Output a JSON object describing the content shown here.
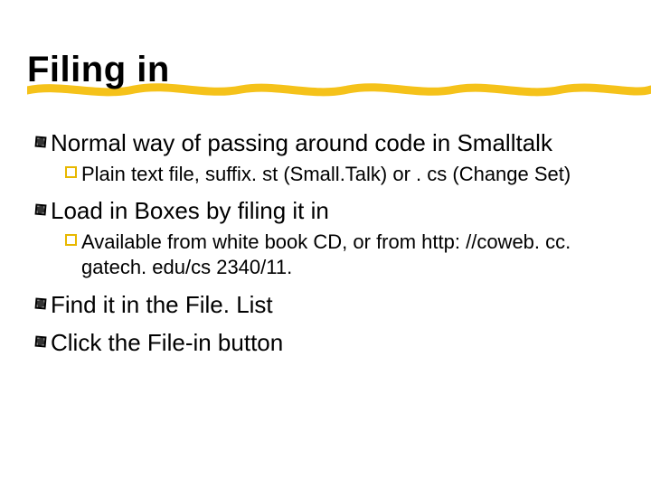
{
  "title": "Filing in",
  "bullets": {
    "b1": "Normal way of passing around code in Smalltalk",
    "b1a": "Plain text file, suffix. st (Small.Talk) or . cs (Change Set)",
    "b2": "Load in Boxes by filing it in",
    "b2a": "Available from white book CD, or from http: //coweb. cc. gatech. edu/cs 2340/11.",
    "b3": "Find it in the File. List",
    "b4": "Click the File-in button"
  },
  "glyphs": {
    "lvl1": "❚",
    "lvl2": "❚"
  }
}
